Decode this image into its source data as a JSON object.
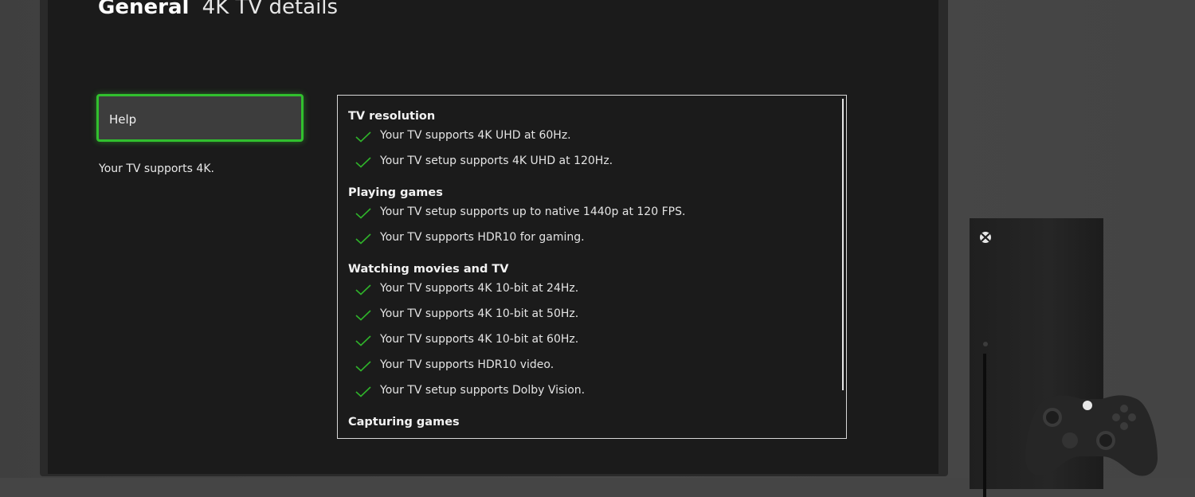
{
  "header": {
    "section": "General",
    "title": "4K TV details"
  },
  "left": {
    "help_label": "Help",
    "description": "Your TV supports 4K."
  },
  "details": {
    "sections": [
      {
        "title": "TV resolution",
        "items": [
          "Your TV supports 4K UHD at 60Hz.",
          "Your TV setup supports 4K UHD at 120Hz."
        ]
      },
      {
        "title": "Playing games",
        "items": [
          "Your TV setup supports up to native 1440p at 120 FPS.",
          "Your TV supports HDR10 for gaming."
        ]
      },
      {
        "title": "Watching movies and TV",
        "items": [
          "Your TV supports 4K 10-bit at 24Hz.",
          "Your TV supports 4K 10-bit at 50Hz.",
          "Your TV supports 4K 10-bit at 60Hz.",
          "Your TV supports HDR10 video.",
          "Your TV setup supports Dolby Vision."
        ]
      },
      {
        "title": "Capturing games",
        "items": []
      }
    ]
  },
  "icons": {
    "check": "check-icon",
    "xbox": "xbox-logo-icon"
  },
  "colors": {
    "focus_green": "#31c02e",
    "check_green": "#2fb32a",
    "screen_bg": "#1b1b1b"
  }
}
